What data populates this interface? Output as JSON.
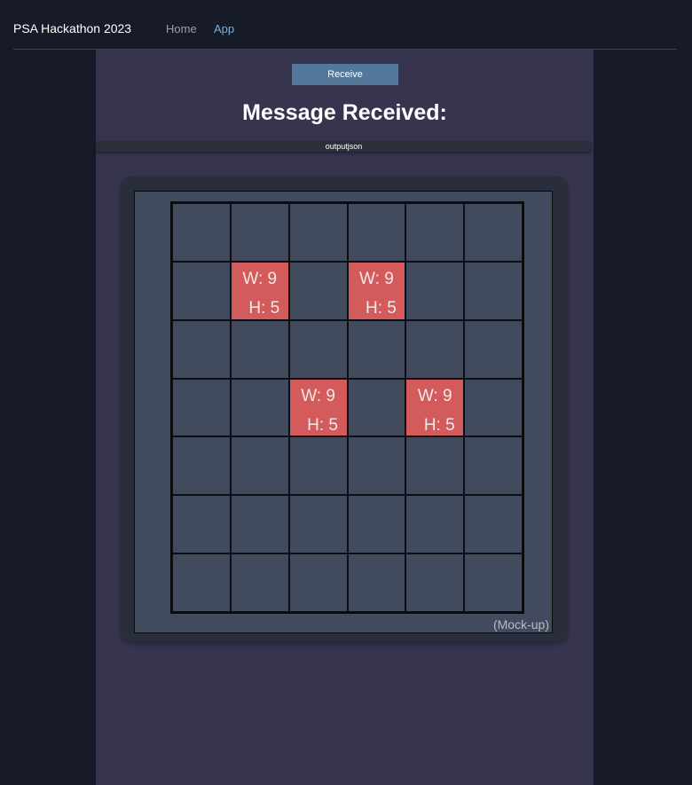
{
  "nav": {
    "brand": "PSA Hackathon 2023",
    "links": [
      {
        "label": "Home",
        "active": false
      },
      {
        "label": "App",
        "active": true
      }
    ]
  },
  "main": {
    "receive_button_label": "Receive",
    "title": "Message Received:",
    "output_label": "outputjson",
    "caption": "(Mock-up)"
  },
  "grid": {
    "rows": 7,
    "columns": 6,
    "cells": [
      [
        null,
        null,
        null,
        null,
        null,
        null
      ],
      [
        null,
        {
          "w": "W: 9",
          "h": "H: 5"
        },
        null,
        {
          "w": "W: 9",
          "h": "H: 5"
        },
        null,
        null
      ],
      [
        null,
        null,
        null,
        null,
        null,
        null
      ],
      [
        null,
        null,
        {
          "w": "W: 9",
          "h": "H: 5"
        },
        null,
        {
          "w": "W: 9",
          "h": "H: 5"
        },
        null
      ],
      [
        null,
        null,
        null,
        null,
        null,
        null
      ],
      [
        null,
        null,
        null,
        null,
        null,
        null
      ],
      [
        null,
        null,
        null,
        null,
        null,
        null
      ]
    ]
  },
  "colors": {
    "page_background": "#161b27",
    "panel_background": "#36344f",
    "button": "#54789c",
    "cell_empty": "#424a5d",
    "cell_filled": "#d35b5b",
    "active_link": "#7aaee0"
  }
}
